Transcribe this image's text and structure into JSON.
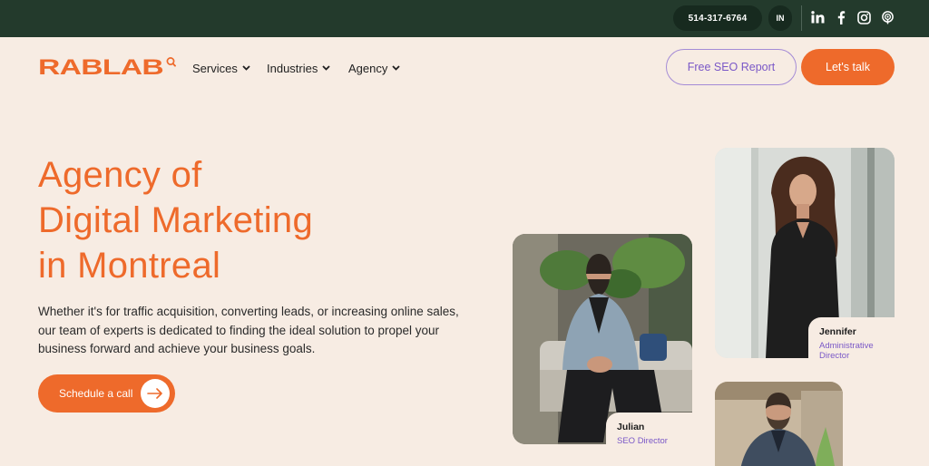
{
  "topbar": {
    "phone": "514-317-6764",
    "language": "IN",
    "socials": [
      {
        "icon": "linkedin-icon",
        "label": "in"
      },
      {
        "icon": "facebook-icon",
        "label": "f"
      },
      {
        "icon": "instagram-icon"
      },
      {
        "icon": "podcast-icon"
      }
    ]
  },
  "nav": {
    "logo": "RABLAB",
    "items": [
      {
        "label": "Services"
      },
      {
        "label": "Industries"
      },
      {
        "label": "Agency"
      }
    ],
    "report_label": "Free SEO Report",
    "talk_label": "Let's talk"
  },
  "hero": {
    "title_lines": [
      "Agency of",
      "Digital Marketing",
      "in Montreal"
    ],
    "description": "Whether it's for traffic acquisition, converting leads, or increasing online sales, our team of experts is dedicated to finding the ideal solution to propel your business forward and achieve your business goals.",
    "cta_label": "Schedule a call"
  },
  "team": [
    {
      "name": "Jennifer",
      "role": "Administrative Director"
    },
    {
      "name": "Julian",
      "role": "SEO Director"
    }
  ],
  "colors": {
    "accent": "#ee6a2b",
    "topbar": "#233a2c",
    "background": "#f7ece3",
    "purple": "#7a58c7"
  }
}
